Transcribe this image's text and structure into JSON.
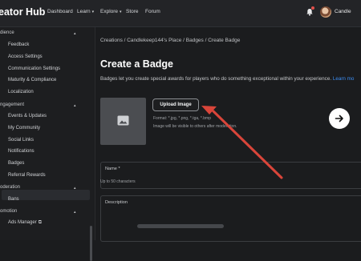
{
  "header": {
    "logo": "eator Hub",
    "nav": [
      "Dashboard",
      "Learn",
      "Explore",
      "Store",
      "Forum"
    ],
    "username": "Candle"
  },
  "sidebar": {
    "sections": [
      {
        "label": "dience",
        "items": [
          "Feedback",
          "Access Settings",
          "Communication Settings",
          "Maturity & Compliance",
          "Localization"
        ]
      },
      {
        "label": "ngagement",
        "items": [
          "Events & Updates",
          "My Community",
          "Social Links",
          "Notifications",
          "Badges",
          "Referral Rewards"
        ]
      },
      {
        "label": "oderation",
        "items": [
          "Bans"
        ]
      },
      {
        "label": "omotion",
        "items": [
          "Ads Manager"
        ]
      }
    ],
    "selected": "Badges"
  },
  "breadcrumb": "Creations  /  Candlekeep144's Place  /  Badges  /  Create Badge",
  "page": {
    "title": "Create a Badge",
    "description": "Badges let you create special awards for players who do something exceptional within your experience.",
    "learn_more": "Learn mo",
    "upload_label": "Upload Image",
    "format_text": "Format: *.jpg, *.png, *.tga, *.bmp",
    "visibility_text": "Image will be visible to others after moderation."
  },
  "form": {
    "name_label": "Name *",
    "name_hint": "Up to 50 characters",
    "description_label": "Description"
  },
  "colors": {
    "accent": "#3c8ef4",
    "annotation_arrow": "#d9453a",
    "background": "#1b1c1e"
  }
}
